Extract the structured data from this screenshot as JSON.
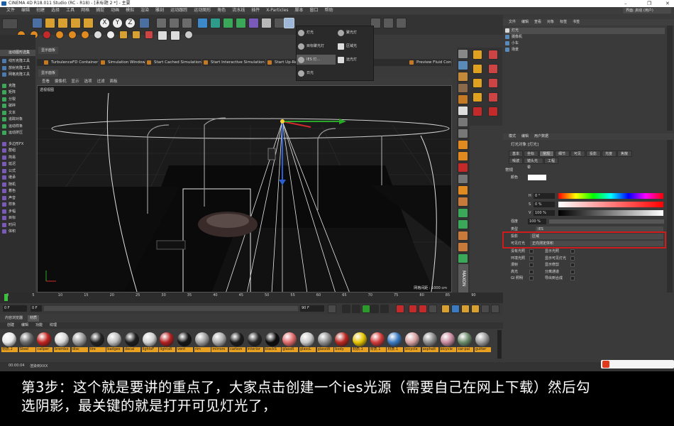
{
  "window": {
    "title": "CINEMA 4D R18.011 Studio (RC - R18) - [未标题 2 *] - 主要",
    "layout_label": "界面: 启动 (用户)"
  },
  "menu": [
    "文件",
    "编辑",
    "创建",
    "选择",
    "工具",
    "网格",
    "捕捉",
    "动画",
    "模拟",
    "渲染",
    "雕刻",
    "运动跟踪",
    "运动图形",
    "角色",
    "流水线",
    "插件",
    "X-Particles",
    "脚本",
    "窗口",
    "帮助"
  ],
  "left_panel": {
    "header": "运动图形选集",
    "items": [
      "线形克隆工具",
      "放射克隆工具",
      "网格克隆工具",
      "克隆",
      "矩阵",
      "分裂",
      "破碎",
      "文本",
      "追踪对象",
      "运动样条",
      "运动挤压",
      "多边形FX",
      "群组",
      "简易",
      "延迟",
      "公式",
      "继承",
      "随机",
      "着色",
      "声音",
      "样条",
      "步幅",
      "目标",
      "时间",
      "体积"
    ],
    "sub_label": "显示面板"
  },
  "sim_bar": [
    "TurbulenceFD Container",
    "Simulation Window",
    "Start Cached Simulation",
    "Start Interactive Simulation",
    "Start Up-Res Simulation",
    "Preview Fluid Container"
  ],
  "viewport": {
    "menu": [
      "查看",
      "摄像机",
      "显示",
      "选项",
      "过滤",
      "面板"
    ],
    "label": "透视视图",
    "grid_distance": "网格间距 : 1000 cm"
  },
  "light_menu": {
    "items": [
      "灯光",
      "目标聚光灯",
      "IES 灯...",
      "日光",
      "聚光灯",
      "区域光",
      "远光灯"
    ]
  },
  "objects": {
    "tabs": [
      "文件",
      "编辑",
      "查看",
      "对象",
      "标签",
      "书签"
    ],
    "rows": [
      "灯光",
      "摄像机",
      "小车",
      "场景"
    ]
  },
  "attributes": {
    "tabs": [
      "模式",
      "编辑",
      "用户数据"
    ],
    "object_name": "灯光对象 [灯光]",
    "subtabs_row1": [
      "基本",
      "坐标",
      "常规",
      "细节",
      "可见",
      "投影",
      "光度",
      "焦散"
    ],
    "subtabs_row2": [
      "噪波",
      "镜头光晕",
      "工程"
    ],
    "section": "常规",
    "color_label": "颜色",
    "h_label": "H",
    "h_value": "0 °",
    "s_label": "S",
    "s_value": "0 %",
    "v_label": "V",
    "v_value": "100 %",
    "intensity_label": "强度",
    "intensity_value": "100 %",
    "type_label": "类型",
    "type_value": "IES",
    "shadow_label": "投影",
    "shadow_value": "区域",
    "visible_label": "可见灯光",
    "visible_value": "正向测定体积",
    "checks_left": [
      "没有光照",
      "环境光照",
      "漫射",
      "高光",
      "GI 照明"
    ],
    "checks_right": [
      "显示光照",
      "显示可见灯光",
      "显示修剪",
      "分离通道",
      "导出到合成"
    ]
  },
  "timeline": {
    "ticks": [
      "0",
      "5",
      "10",
      "15",
      "20",
      "25",
      "30",
      "35",
      "40",
      "45",
      "50",
      "55",
      "60",
      "65",
      "70",
      "75",
      "80",
      "85",
      "90"
    ],
    "frame_start": "0 F",
    "frame_cur": "0 F",
    "frame_end": "90 F",
    "frame_end2": "90 F"
  },
  "materials": {
    "tabs": [
      "内容浏览器",
      "材质"
    ],
    "menu": [
      "创建",
      "编辑",
      "功能",
      "纹理"
    ],
    "items": [
      {
        "name": "材质.2",
        "color": "#e8e8e8"
      },
      {
        "name": "Steel",
        "color": "#6a6a6a"
      },
      {
        "name": "caliper",
        "color": "#c0241f"
      },
      {
        "name": "brembo",
        "color": "#d8d8d8"
      },
      {
        "name": "disc",
        "color": "#9a9a9a"
      },
      {
        "name": "tire",
        "color": "#222222"
      },
      {
        "name": "badges",
        "color": "#bdbdbd"
      },
      {
        "name": "decal",
        "color": "#1e1e1e"
      },
      {
        "name": "lightsF",
        "color": "#cfcfcf"
      },
      {
        "name": "lightsR",
        "color": "#b32020"
      },
      {
        "name": "vent",
        "color": "#161616"
      },
      {
        "name": "rim",
        "color": "#9c9c9c"
      },
      {
        "name": "mirrors",
        "color": "#aaaaaa"
      },
      {
        "name": "carbon",
        "color": "#1b1b1b"
      },
      {
        "name": "interior",
        "color": "#262626"
      },
      {
        "name": "blackS",
        "color": "#0c0c0c"
      },
      {
        "name": "glassR",
        "color": "#e06b6b"
      },
      {
        "name": "glassL",
        "color": "#c8c8c8"
      },
      {
        "name": "glassW",
        "color": "#8f8f8f"
      },
      {
        "name": "body",
        "color": "#b8261f"
      },
      {
        "name": "材质.1",
        "color": "#e6c400"
      },
      {
        "name": "材质.1",
        "color": "#d23a3a"
      },
      {
        "name": "材质.1",
        "color": "#3a79c0"
      },
      {
        "name": "bicycle",
        "color": "#d6a0a0"
      },
      {
        "name": "asphalt",
        "color": "#8a8a8a"
      },
      {
        "name": "bicycle",
        "color": "#c98aa0"
      },
      {
        "name": "car-pai",
        "color": "#6a8a6a"
      },
      {
        "name": "gutter",
        "color": "#9a9a9a"
      }
    ]
  },
  "status": {
    "time": "00:00:04",
    "info": "渲染到XXX"
  },
  "caption": "第3步：这个就是要讲的重点了，大家点击创建一个ies光源（需要自己在网上下载）然后勾\n选阴影，最关键的就是打开可见灯光了，"
}
